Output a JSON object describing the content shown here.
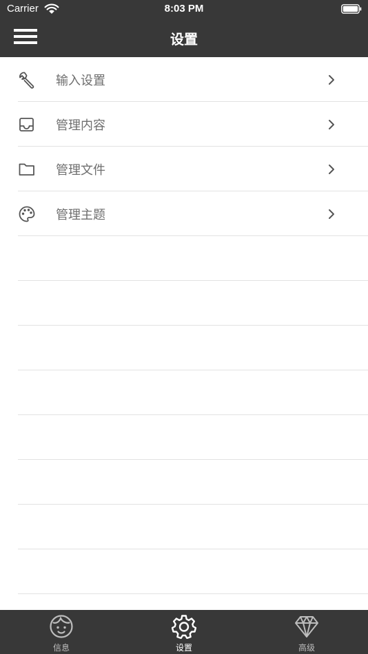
{
  "status_bar": {
    "carrier": "Carrier",
    "time": "8:03 PM"
  },
  "header": {
    "title": "设置",
    "menu_icon": "hamburger-icon"
  },
  "settings": {
    "items": [
      {
        "label": "输入设置",
        "icon": "wrench-icon"
      },
      {
        "label": "管理内容",
        "icon": "inbox-icon"
      },
      {
        "label": "管理文件",
        "icon": "folder-icon"
      },
      {
        "label": "管理主题",
        "icon": "palette-icon"
      }
    ],
    "empty_rows": 8
  },
  "tabbar": {
    "tabs": [
      {
        "label": "信息",
        "icon": "face-icon",
        "active": false
      },
      {
        "label": "设置",
        "icon": "gear-icon",
        "active": true
      },
      {
        "label": "高级",
        "icon": "diamond-icon",
        "active": false
      }
    ]
  },
  "colors": {
    "bar_background": "#383838",
    "list_text": "#6e6e6e",
    "divider": "#e2e2e2",
    "tab_inactive": "#bdbdbd",
    "tab_active": "#ffffff"
  }
}
